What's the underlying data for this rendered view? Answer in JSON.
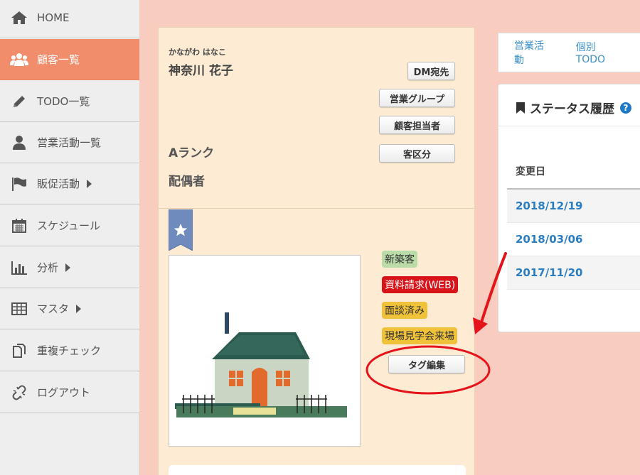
{
  "sidebar": {
    "items": [
      {
        "label": "HOME",
        "icon": "home-icon"
      },
      {
        "label": "顧客一覧",
        "icon": "users-icon"
      },
      {
        "label": "TODO一覧",
        "icon": "pencil-icon"
      },
      {
        "label": "営業活動一覧",
        "icon": "person-icon"
      },
      {
        "label": "販促活動",
        "icon": "flag-icon"
      },
      {
        "label": "スケジュール",
        "icon": "calendar-icon"
      },
      {
        "label": "分析",
        "icon": "bar-chart-icon"
      },
      {
        "label": "マスタ",
        "icon": "table-icon"
      },
      {
        "label": "重複チェック",
        "icon": "copy-icon"
      },
      {
        "label": "ログアウト",
        "icon": "unlink-icon"
      }
    ]
  },
  "customer": {
    "kana": "かながわ はなこ",
    "name": "神奈川 花子",
    "rank": "Aランク",
    "spouse": "配偶者"
  },
  "buttons": {
    "dm": "DM宛先",
    "sales_group": "営業グループ",
    "customer_rep": "顧客担当者",
    "customer_class": "客区分",
    "tag_edit": "タグ編集"
  },
  "tags": [
    {
      "label": "新築客",
      "bg": "#b9dca8",
      "color": "#333333"
    },
    {
      "label": "資料請求(WEB)",
      "bg": "#d9131a",
      "color": "#ffffff"
    },
    {
      "label": "面談済み",
      "bg": "#f0c23a",
      "color": "#333333"
    },
    {
      "label": "現場見学会来場",
      "bg": "#f0c23a",
      "color": "#333333"
    }
  ],
  "tabs": {
    "sales_activity": "営業活動",
    "individual_todo": "個別TODO"
  },
  "status": {
    "title": "ステータス履歴",
    "help": "?",
    "column": "変更日",
    "rows": [
      "2018/12/19",
      "2018/03/06",
      "2017/11/20"
    ]
  },
  "colors": {
    "accent": "#f28d6b",
    "page_bg": "#f8cdbf",
    "card_bg": "#fdecd3",
    "link": "#2a7dc0",
    "annotation": "#e5131a"
  }
}
